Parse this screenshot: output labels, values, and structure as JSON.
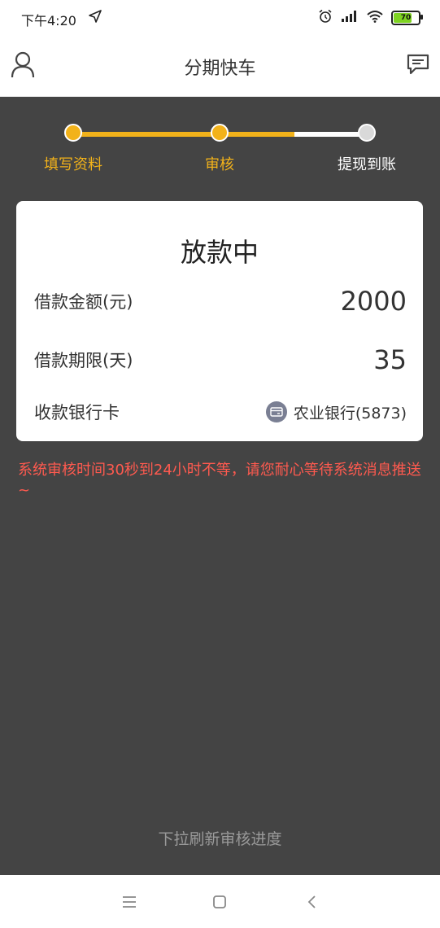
{
  "status_bar": {
    "time": "下午4:20",
    "battery": "70"
  },
  "header": {
    "title": "分期快车"
  },
  "steps": [
    {
      "label": "填写资料"
    },
    {
      "label": "审核"
    },
    {
      "label": "提现到账"
    }
  ],
  "card": {
    "status": "放款中",
    "amount_label": "借款金额(元)",
    "amount_value": "2000",
    "term_label": "借款期限(天)",
    "term_value": "35",
    "bank_label": "收款银行卡",
    "bank_value": "农业银行(5873)"
  },
  "notice": "系统审核时间30秒到24小时不等，请您耐心等待系统消息推送~",
  "pull_hint": "下拉刷新审核进度",
  "colors": {
    "accent": "#f2b21a",
    "notice": "#ff5a4f",
    "background": "#444444"
  },
  "icons": [
    "location-arrow-icon",
    "alarm-icon",
    "signal-icon",
    "wifi-icon",
    "battery-icon",
    "user-icon",
    "message-icon",
    "bank-card-icon",
    "menu-icon",
    "home-icon",
    "back-icon"
  ]
}
